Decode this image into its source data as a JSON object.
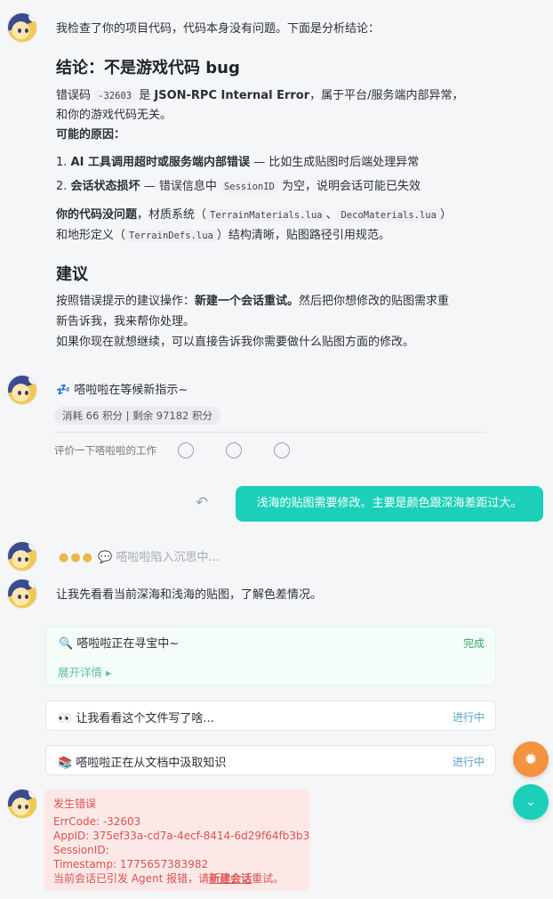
{
  "msg1": {
    "intro": "我检查了你的项目代码，代码本身没有问题。下面是分析结论：",
    "h_conclusion": "结论：不是游戏代码 bug",
    "err_pre": "错误码",
    "err_code": "-32603",
    "err_mid": "是",
    "err_bold": "JSON-RPC Internal Error",
    "err_post": "，属于平台/服务端内部异常，",
    "err_line2": "和你的游戏代码无关。",
    "causes_title": "可能的原因：",
    "cause1_num": "1.",
    "cause1_bold": "AI 工具调用超时或服务端内部错误",
    "cause1_rest": " — 比如生成贴图时后端处理异常",
    "cause2_num": "2.",
    "cause2_bold": "会话状态损坏",
    "cause2_pre": " — 错误信息中",
    "cause2_code": "SessionID",
    "cause2_post": "为空，说明会话可能已失效",
    "code_ok_bold": "你的代码没问题",
    "code_ok_1": "，材质系统（",
    "code_file1": "TerrainMaterials.lua",
    "code_sep": "、",
    "code_file2": "DecoMaterials.lua",
    "code_close": "）",
    "code_ok_2": "和地形定义（",
    "code_file3": "TerrainDefs.lua",
    "code_ok_3": "）结构清晰，贴图路径引用规范。",
    "h_suggest": "建议",
    "sug1_pre": "按照错误提示的建议操作：",
    "sug1_bold": "新建一个会话重试。",
    "sug1_post": "然后把你想修改的贴图需求重",
    "sug1_line2": "新告诉我，我来帮你处理。",
    "sug2": "如果你现在就想继续，可以直接告诉我你需要做什么贴图方面的修改。"
  },
  "msg2": {
    "waiting": "嗒啦啦在等候新指示~",
    "cost": "消耗 66 积分 | 剩余 97182 积分",
    "rate_label": "评价一下嗒啦啦的工作"
  },
  "user_msg": "浅海的贴图需要修改。主要是颜色跟深海差距过大。",
  "thinking": "嗒啦啦陷入沉思中...",
  "msg3": {
    "intro": "让我先看看当前深海和浅海的贴图，了解色差情况。",
    "task1_label": "嗒啦啦正在寻宝中~",
    "task1_status": "完成",
    "task1_expand": "展开详情",
    "task2_label": "让我看看这个文件写了啥...",
    "task2_status": "进行中",
    "task3_label": "嗒啦啦正在从文档中汲取知识",
    "task3_status": "进行中"
  },
  "error": {
    "title": "发生错误",
    "errcode": "ErrCode: -32603",
    "appid": "AppID: 375ef33a-cd7a-4ecf-8414-6d29f64fb3b3",
    "session": "SessionID:",
    "timestamp": "Timestamp: 1775657383982",
    "tip_pre": "当前会话已引发 Agent 报错，请",
    "tip_link": "新建会话",
    "tip_post": "重试。"
  },
  "colors": {
    "accent": "#1ccfb9",
    "fab_orange": "#f5923e",
    "fab_teal": "#1ccfb9",
    "error_bg": "#fde8e8",
    "error_text": "#d9534f"
  }
}
